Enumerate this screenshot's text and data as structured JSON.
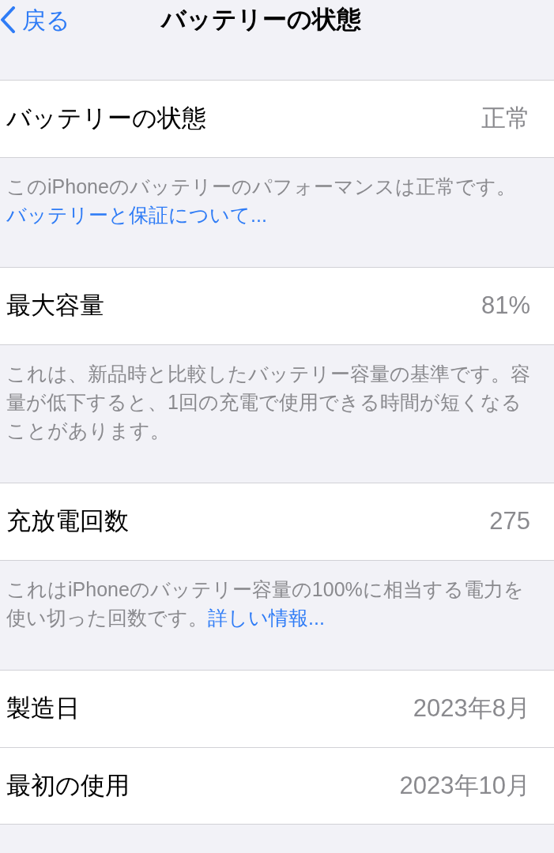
{
  "nav": {
    "back": "戻る",
    "title": "バッテリーの状態"
  },
  "sections": [
    {
      "rows": [
        {
          "label": "バッテリーの状態",
          "value": "正常"
        }
      ],
      "footer": {
        "text": "このiPhoneのバッテリーのパフォーマンスは正常です。",
        "link": "バッテリーと保証について..."
      }
    },
    {
      "rows": [
        {
          "label": "最大容量",
          "value": "81%"
        }
      ],
      "footer": {
        "text": "これは、新品時と比較したバッテリー容量の基準です。容量が低下すると、1回の充電で使用できる時間が短くなることがあります。"
      }
    },
    {
      "rows": [
        {
          "label": "充放電回数",
          "value": "275"
        }
      ],
      "footer": {
        "text": "これはiPhoneのバッテリー容量の100%に相当する電力を使い切った回数です。",
        "link": "詳しい情報..."
      }
    },
    {
      "rows": [
        {
          "label": "製造日",
          "value": "2023年8月"
        },
        {
          "label": "最初の使用",
          "value": "2023年10月"
        }
      ]
    }
  ]
}
